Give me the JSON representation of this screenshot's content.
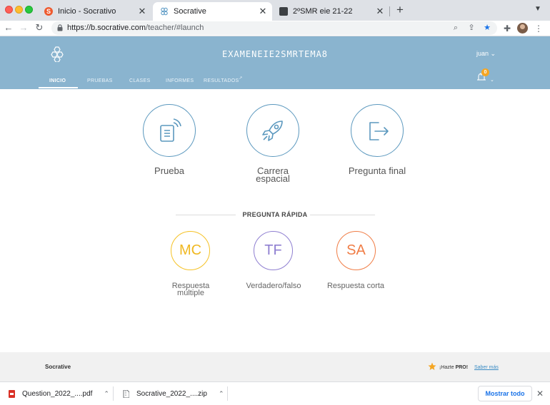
{
  "browser": {
    "tabs": [
      {
        "title": "Inicio - Socrativo",
        "favicon": "socrative-s-favicon",
        "active": false
      },
      {
        "title": "Socrative",
        "favicon": "socrative-hex-favicon",
        "active": true
      },
      {
        "title": "2ºSMR eie 21-22",
        "favicon": "classroom-card-favicon",
        "active": false
      }
    ],
    "new_tab_label": "+",
    "url_host": "https://b.socrative.com",
    "url_path": "/teacher/#launch"
  },
  "header": {
    "room_name": "EXAMENEIE2SMRTEMA8",
    "user_label": "juan",
    "notification_count": "0",
    "nav": [
      {
        "label": "INICIO",
        "active": true
      },
      {
        "label": "PRUEBAS",
        "active": false
      },
      {
        "label": "CLASES",
        "active": false
      },
      {
        "label": "INFORMES",
        "active": false
      },
      {
        "label": "RESULTADOS",
        "active": false
      }
    ]
  },
  "launch": {
    "items": [
      {
        "label": "Prueba",
        "icon": "quiz-icon"
      },
      {
        "label": "Carrera\nespacial",
        "icon": "rocket-icon"
      },
      {
        "label": "Pregunta final",
        "icon": "exit-ticket-icon"
      }
    ]
  },
  "quick_question": {
    "title": "PREGUNTA RÁPIDA",
    "items": [
      {
        "abbr": "MC",
        "label": "Respuesta\nmúltiple",
        "color": "#f0b821"
      },
      {
        "abbr": "TF",
        "label": "Verdadero/falso",
        "color": "#8f7fd1"
      },
      {
        "abbr": "SA",
        "label": "Respuesta corta",
        "color": "#f07d46"
      }
    ]
  },
  "footer": {
    "brand": "Socrative",
    "pro_prefix": "¡Hazte ",
    "pro_bold": "PRO!",
    "learn_more": "Saber más"
  },
  "downloads": {
    "items": [
      {
        "name": "Question_2022_....pdf",
        "icon": "pdf-file-icon"
      },
      {
        "name": "Socrative_2022_....zip",
        "icon": "zip-file-icon"
      }
    ],
    "show_all": "Mostrar todo"
  },
  "colors": {
    "header_bg": "#8ab4cf",
    "launch_accent": "#5b98be",
    "link": "#3a8bc4"
  }
}
